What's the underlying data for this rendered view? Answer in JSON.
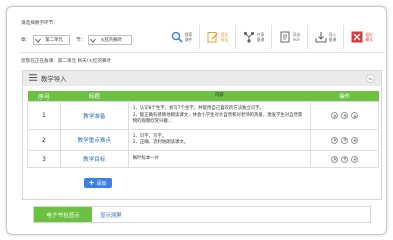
{
  "selector": {
    "title": "请选择教学环节：",
    "chapter_label": "章：",
    "chapter_value": "第二单元",
    "section_label": "节：",
    "section_value": "火红的枫叶"
  },
  "toolbar": {
    "items": [
      {
        "line1": "搜索",
        "line2": "课件",
        "icon": "search-icon"
      },
      {
        "line1": "提交",
        "line2": "报告",
        "icon": "pencil-icon"
      },
      {
        "line1": "共享",
        "line2": "备课",
        "icon": "share-icon"
      },
      {
        "line1": "导出",
        "line2": "PDF",
        "icon": "pdf-icon"
      },
      {
        "line1": "导入",
        "line2": "备课",
        "icon": "import-icon"
      },
      {
        "line1": "退出",
        "line2": "模式",
        "icon": "exit-icon"
      }
    ]
  },
  "current_selection": "您现在正在备课：第二单元  秋天/火红的枫叶",
  "panel": {
    "title": "教学导入",
    "columns": [
      "序号",
      "标题",
      "内容",
      "操作"
    ],
    "rows": [
      {
        "num": "1",
        "title": "教学准备",
        "content_lines": [
          "1、认识8个生字，会写7个生字，并能用自己喜欢的方法独立识字。",
          "2、能正确有感情地朗读课文，体会小学生对大自然和对老师的热爱，激发学生对自然景物的观察欣赏兴趣..."
        ]
      },
      {
        "num": "2",
        "title": "教学重点难点",
        "content_lines": [
          "1、识字、写字。",
          "2、正确、流利地朗读课文。"
        ]
      },
      {
        "num": "3",
        "title": "教学目标",
        "content_lines": [
          "枫叶标本一片"
        ]
      }
    ],
    "add_label": "添加"
  },
  "ebook": {
    "tab": "电子书包显示",
    "link": "显示测屏"
  },
  "colors": {
    "green": "#6cc143",
    "blue": "#3a7ee8",
    "link": "#2c6fbd",
    "orange": "#e8a040",
    "red": "#d9383a"
  }
}
